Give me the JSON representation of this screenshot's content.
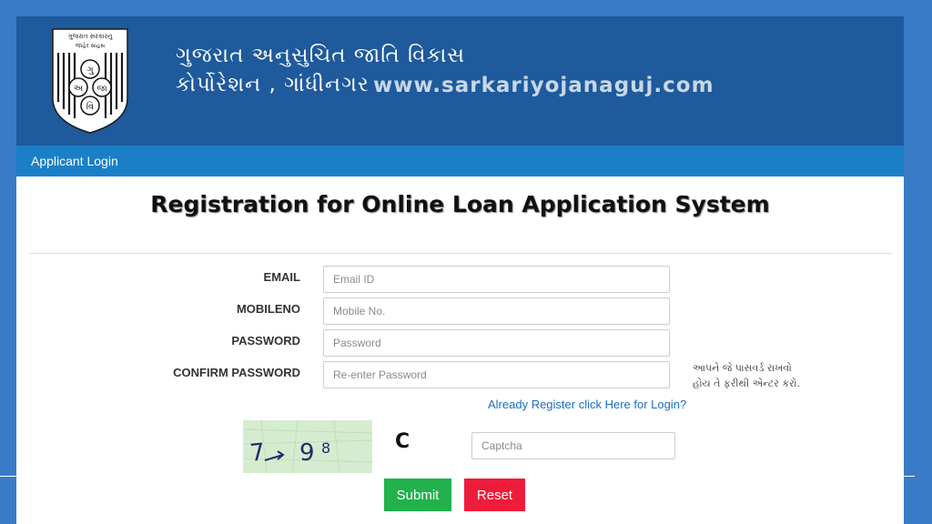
{
  "header": {
    "org_line1": "ગુજરાત અનુસુચિત જાતિ વિકાસ",
    "org_line2": "કોર્પોરેશન , ગાંધીનગર",
    "watermark": "www.sarkariyojanaguj.com",
    "logo": {
      "icon": "emblem-shield-icon",
      "top_text": "ગુજરાત સરકારનુ",
      "sub_text": "જાહેર સાહસ",
      "letters": [
        "ગુ",
        "અ",
        "જા",
        "વિ"
      ]
    }
  },
  "nav": {
    "applicant_login": "Applicant Login"
  },
  "page": {
    "title": "Registration for Online Loan Application System"
  },
  "form": {
    "email": {
      "label": "EMAIL",
      "placeholder": "Email ID"
    },
    "mobile": {
      "label": "MOBILENO",
      "placeholder": "Mobile No."
    },
    "password": {
      "label": "PASSWORD",
      "placeholder": "Password"
    },
    "confirm_password": {
      "label": "CONFIRM PASSWORD",
      "placeholder": "Re-enter Password"
    },
    "hint_line1": "આપને જે પાસવર્ડ રાખવો",
    "hint_line2": "હોય તે ફરીથી એન્ટર કરો.",
    "login_link": "Already Register click Here for Login?",
    "captcha": {
      "chars": [
        "7",
        "9",
        "8"
      ],
      "refresh_symbol": "C",
      "refresh_icon": "refresh-icon",
      "placeholder": "Captcha"
    },
    "submit_label": "Submit",
    "reset_label": "Reset"
  },
  "colors": {
    "banner": "#1e5a9c",
    "navbar": "#1a7fc7",
    "outer_background": "#3a7bc8",
    "submit": "#22b14c",
    "reset": "#ee1c3a",
    "link": "#1a6fc4",
    "captcha_bg": "#d6ecd0"
  }
}
